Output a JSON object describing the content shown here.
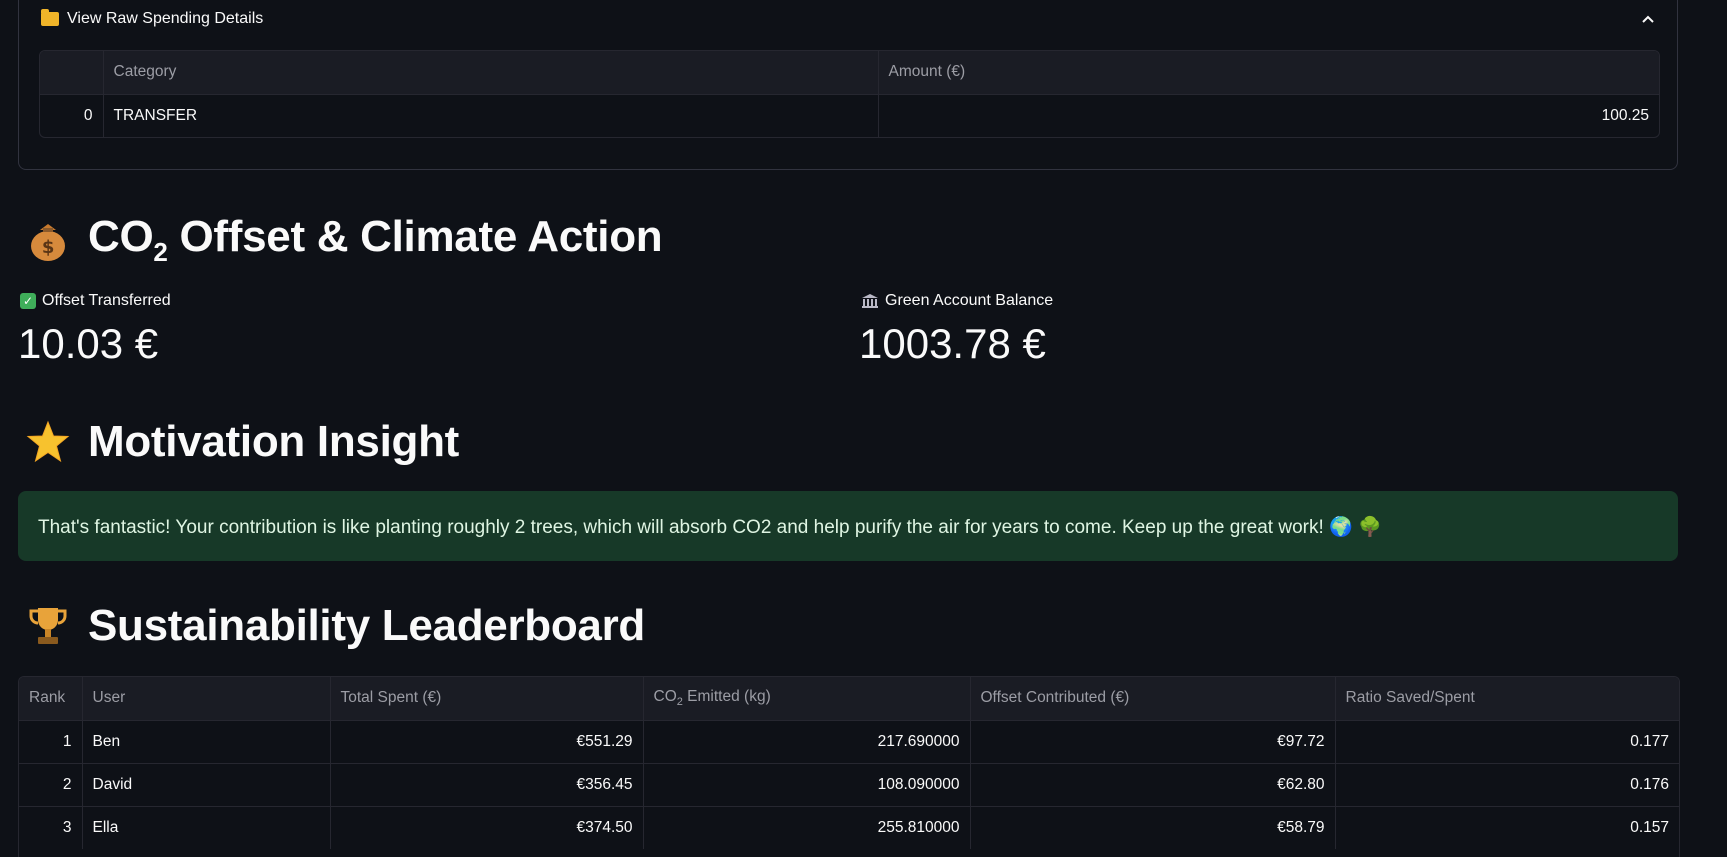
{
  "expander": {
    "title": "View Raw Spending Details",
    "columns": [
      "",
      "Category",
      "Amount (€)"
    ],
    "rows": [
      {
        "index": "0",
        "category": "TRANSFER",
        "amount": "100.25"
      }
    ]
  },
  "offset_section": {
    "icon": "money-bag-icon",
    "title_prefix": "CO",
    "title_sub": "2",
    "title_suffix": " Offset & Climate Action",
    "metrics": [
      {
        "icon": "check-icon",
        "label": "Offset Transferred",
        "value": "10.03 €"
      },
      {
        "icon": "bank-icon",
        "label": "Green Account Balance",
        "value": "1003.78 €"
      }
    ]
  },
  "motivation_section": {
    "icon": "star-icon",
    "title": "Motivation Insight",
    "message": "That's fantastic! Your contribution is like planting roughly 2 trees, which will absorb CO2 and help purify the air for years to come. Keep up the great work! 🌍 🌳"
  },
  "leaderboard_section": {
    "icon": "trophy-icon",
    "title": "Sustainability Leaderboard",
    "columns": {
      "rank": "Rank",
      "user": "User",
      "total_spent": "Total Spent (€)",
      "co2_prefix": "CO",
      "co2_sub": "2",
      "co2_suffix": " Emitted (kg)",
      "offset": "Offset Contributed (€)",
      "ratio": "Ratio Saved/Spent"
    },
    "rows": [
      {
        "rank": "1",
        "user": "Ben",
        "total_spent": "€551.29",
        "co2": "217.690000",
        "offset": "€97.72",
        "ratio": "0.177"
      },
      {
        "rank": "2",
        "user": "David",
        "total_spent": "€356.45",
        "co2": "108.090000",
        "offset": "€62.80",
        "ratio": "0.176"
      },
      {
        "rank": "3",
        "user": "Ella",
        "total_spent": "€374.50",
        "co2": "255.810000",
        "offset": "€58.79",
        "ratio": "0.157"
      }
    ]
  },
  "colors": {
    "background": "#0e1117",
    "success_bg": "#173928",
    "success_text": "#dff5e3"
  }
}
